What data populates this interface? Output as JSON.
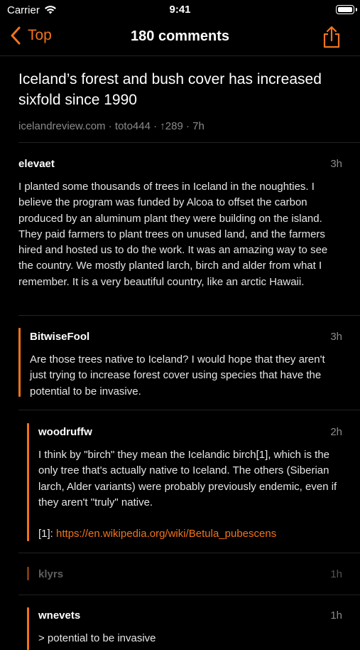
{
  "status_bar": {
    "carrier": "Carrier",
    "time": "9:41"
  },
  "nav": {
    "back_label": "Top",
    "title": "180 comments"
  },
  "story": {
    "title": "Iceland’s forest and bush cover has increased sixfold since 1990",
    "domain": "icelandreview.com",
    "author": "toto444",
    "points": "↑289",
    "age": "7h"
  },
  "comments": [
    {
      "author": "elevaet",
      "age": "3h",
      "text": "I planted some thousands of trees in Iceland in the noughties. I believe the program was funded by Alcoa to offset the carbon produced by an aluminum plant they were building on the island. They paid farmers to plant trees on unused land, and the farmers hired and hosted us to do the work. It was an amazing way to see the country. We mostly planted larch, birch and alder from what I remember. It is a very beautiful country, like an arctic Hawaii."
    },
    {
      "author": "BitwiseFool",
      "age": "3h",
      "text": "Are those trees native to Iceland? I would hope that they aren't just trying to increase forest cover using species that have the potential to be invasive."
    },
    {
      "author": "woodruffw",
      "age": "2h",
      "text": "I think by \"birch\" they mean the Icelandic birch[1], which is the only tree that's actually native to Iceland. The others (Siberian larch, Alder variants) were probably previously endemic, even if they aren't \"truly\" native.",
      "footnote_label": "[1]: ",
      "link": "https://en.wikipedia.org/wiki/Betula_pubescens"
    },
    {
      "author": "klyrs",
      "age": "1h"
    },
    {
      "author": "wnevets",
      "age": "1h",
      "text": "> potential to be invasive"
    }
  ],
  "colors": {
    "accent": "#f2731c",
    "background": "#000000"
  }
}
